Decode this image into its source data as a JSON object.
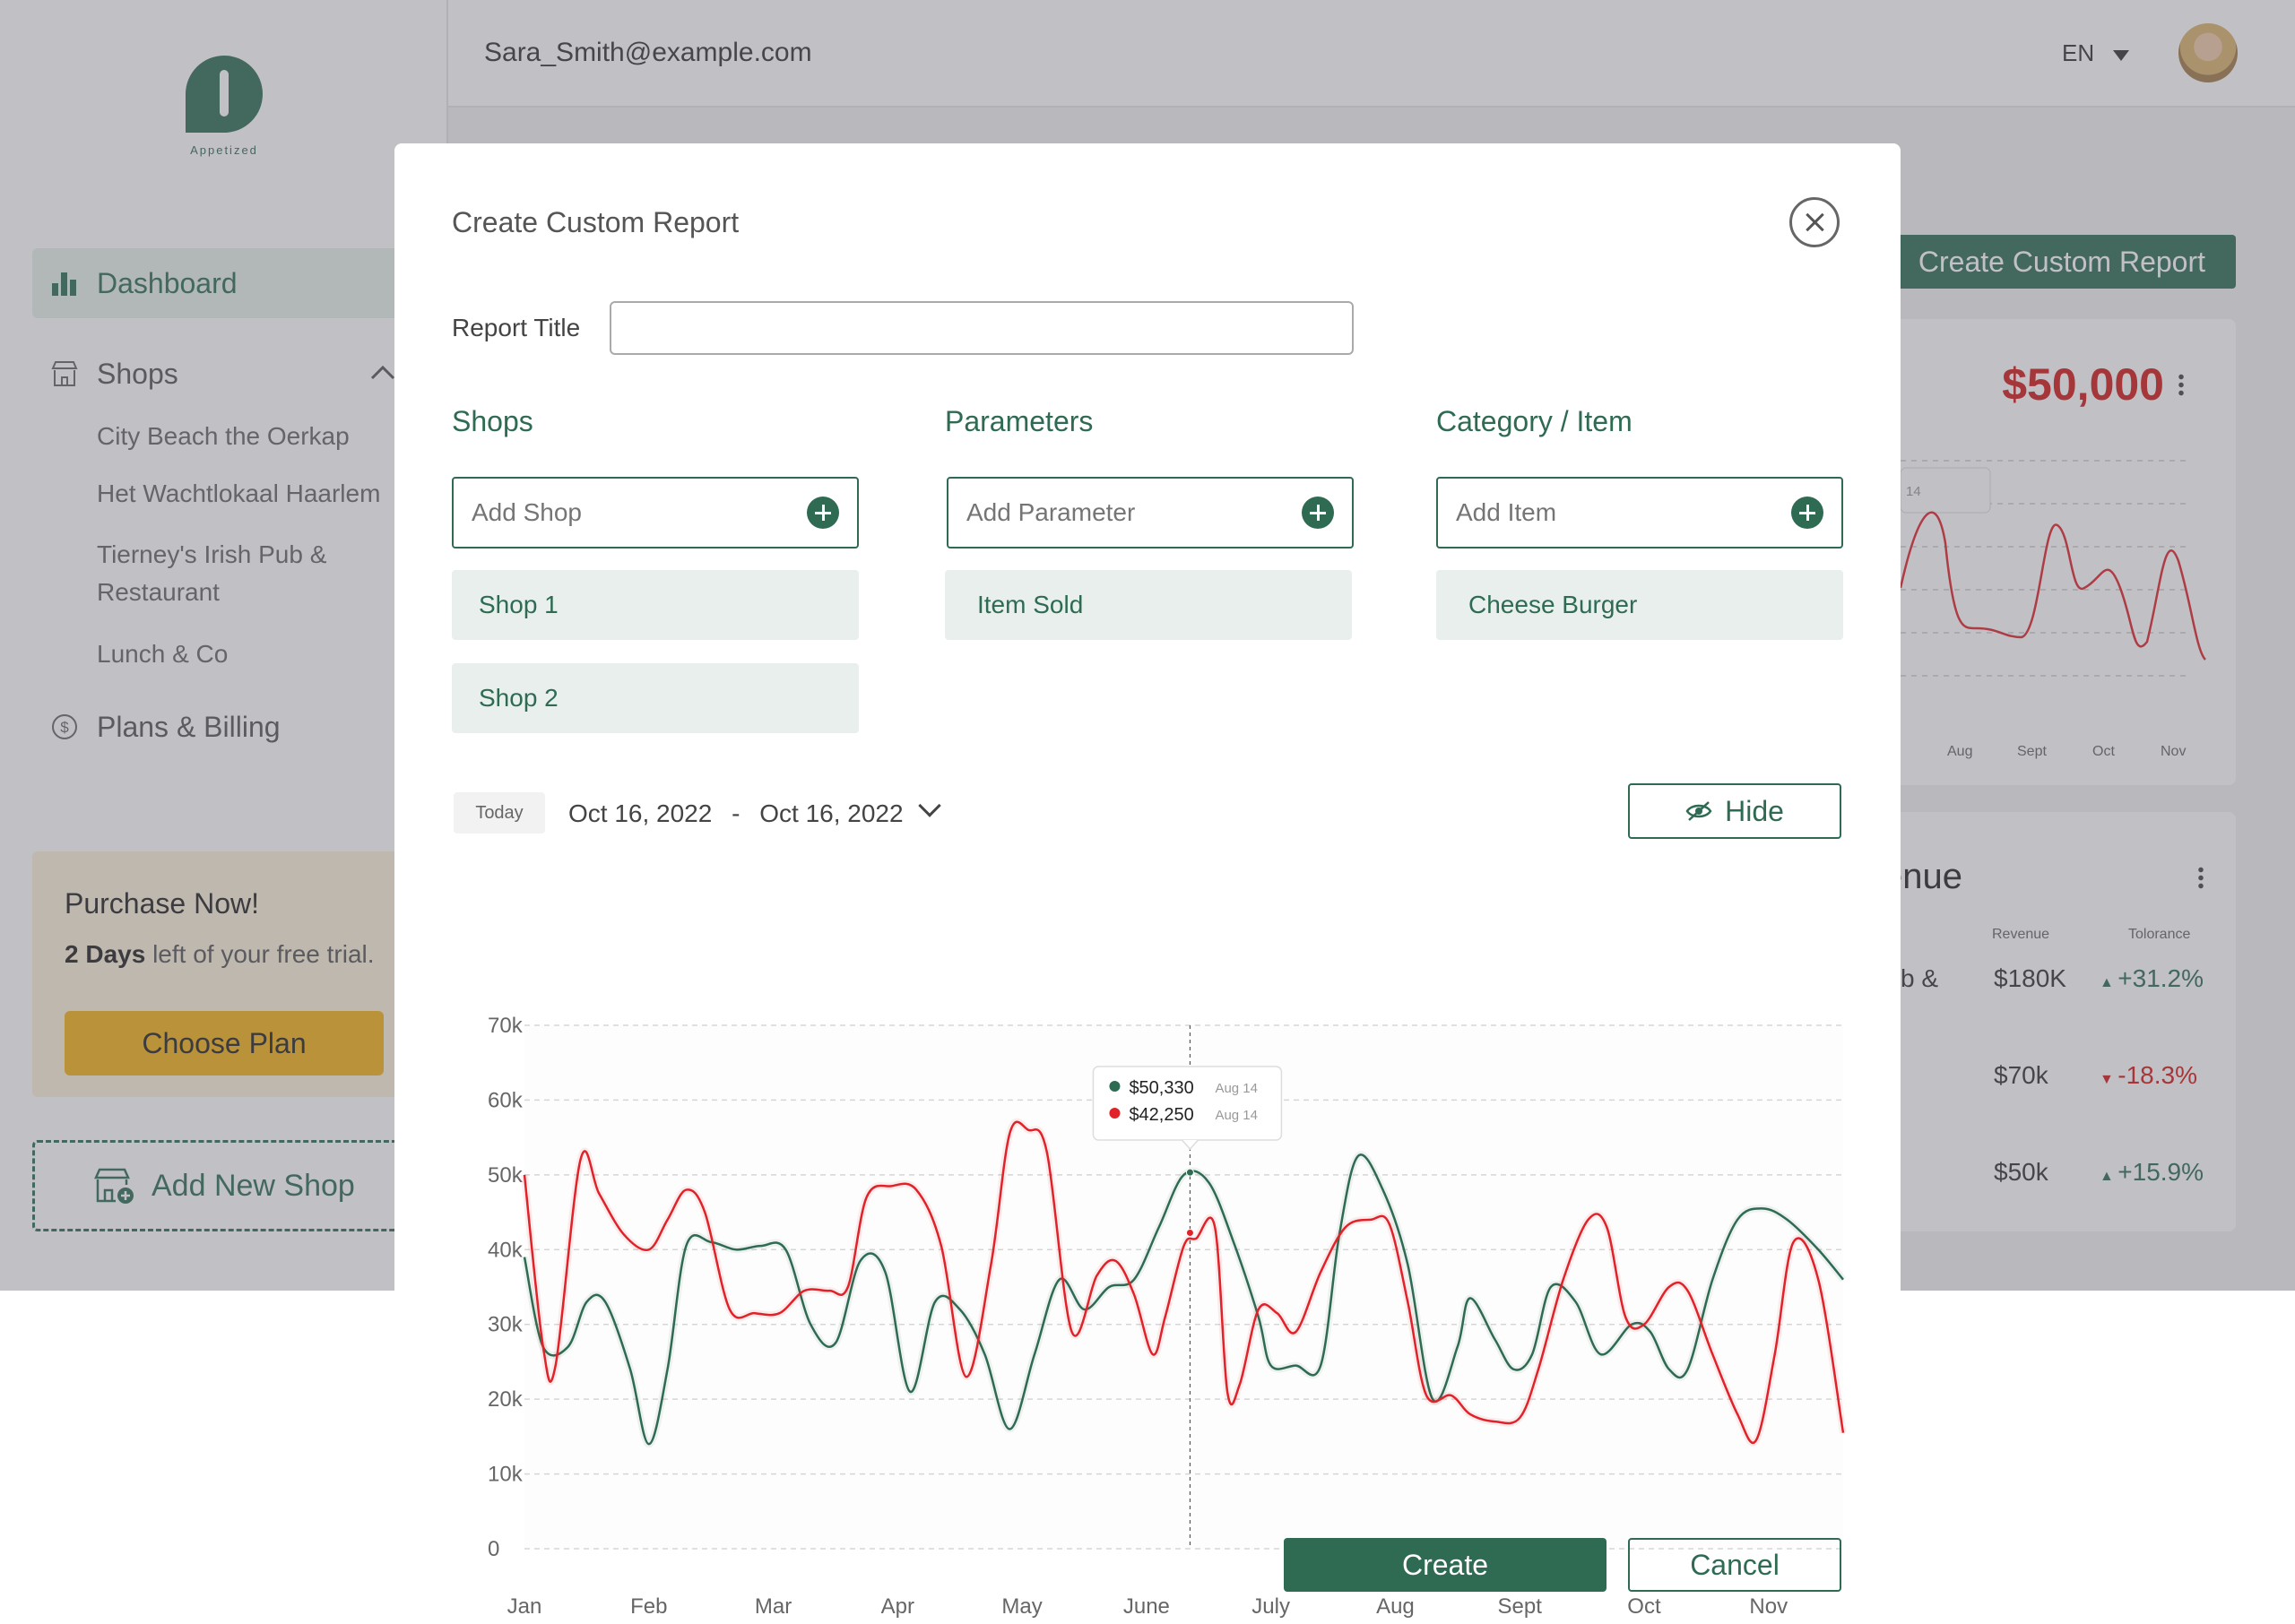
{
  "app": {
    "brand": "Appetized",
    "user_email": "Sara_Smith@example.com",
    "language": "EN",
    "sidebar": {
      "dashboard": "Dashboard",
      "shops": "Shops",
      "shop_items": [
        "City Beach the Oerkap",
        "Het Wachtlokaal Haarlem",
        "Tierney's Irish Pub &",
        "Restaurant",
        "Lunch & Co"
      ],
      "plans_billing": "Plans & Billing"
    },
    "purchase": {
      "title": "Purchase Now!",
      "trial_bold": "2 Days",
      "trial_rest": " left of your free trial.",
      "choose_plan": "Choose Plan"
    },
    "add_new_shop": "Add New Shop",
    "create_custom_report_button": "Create Custom Report",
    "revenue_card": {
      "value": "$50,000",
      "x_labels": [
        "Aug",
        "Sept",
        "Oct",
        "Nov"
      ],
      "tooltip_partial": "14"
    },
    "revenue_list": {
      "title_partial": "enue",
      "col_revenue": "Revenue",
      "col_tolerance": "Tolorance",
      "row_label_partial": "b &",
      "rows": [
        {
          "revenue": "$180K",
          "change": "+31.2%",
          "direction": "up"
        },
        {
          "revenue": "$70k",
          "change": "-18.3%",
          "direction": "down"
        },
        {
          "revenue": "$50k",
          "change": "+15.9%",
          "direction": "up"
        }
      ]
    }
  },
  "modal": {
    "title": "Create Custom Report",
    "report_title_label": "Report Title",
    "report_title_value": "",
    "columns": [
      {
        "title": "Shops",
        "placeholder": "Add Shop",
        "chips": [
          "Shop 1",
          "Shop 2"
        ]
      },
      {
        "title": "Parameters",
        "placeholder": "Add Parameter",
        "chips": [
          "Item Sold"
        ]
      },
      {
        "title": "Category / Item",
        "placeholder": "Add Item",
        "chips": [
          "Cheese Burger"
        ]
      }
    ],
    "today": "Today",
    "date_start": "Oct 16, 2022",
    "date_sep": "-",
    "date_end": "Oct 16, 2022",
    "hide": "Hide",
    "create": "Create",
    "cancel": "Cancel"
  },
  "colors": {
    "brand_green": "#2e6b52",
    "series_red": "#e0222b",
    "accent_gold": "#f2b117"
  },
  "chart_data": {
    "type": "line",
    "categories": [
      "Jan",
      "Feb",
      "Mar",
      "Apr",
      "May",
      "June",
      "July",
      "Aug",
      "Sept",
      "Oct",
      "Nov"
    ],
    "ylim": [
      0,
      70000
    ],
    "y_ticks": [
      "0",
      "10k",
      "20k",
      "30k",
      "40k",
      "50k",
      "60k",
      "70k"
    ],
    "x_range": [
      0,
      10.6
    ],
    "grid": true,
    "series": [
      {
        "color": "#2e6b52",
        "points": [
          [
            0,
            39000
          ],
          [
            0.15,
            27000
          ],
          [
            0.35,
            27000
          ],
          [
            0.5,
            33000
          ],
          [
            0.65,
            33000
          ],
          [
            0.85,
            24000
          ],
          [
            1.0,
            14000
          ],
          [
            1.15,
            24000
          ],
          [
            1.3,
            40500
          ],
          [
            1.5,
            41000
          ],
          [
            1.7,
            40000
          ],
          [
            1.9,
            40500
          ],
          [
            2.1,
            40000
          ],
          [
            2.3,
            30000
          ],
          [
            2.5,
            27500
          ],
          [
            2.7,
            38500
          ],
          [
            2.9,
            37000
          ],
          [
            3.1,
            21000
          ],
          [
            3.3,
            33000
          ],
          [
            3.5,
            32000
          ],
          [
            3.7,
            26000
          ],
          [
            3.9,
            16000
          ],
          [
            4.1,
            26000
          ],
          [
            4.3,
            36000
          ],
          [
            4.5,
            32000
          ],
          [
            4.7,
            35000
          ],
          [
            4.9,
            36000
          ],
          [
            5.1,
            43000
          ],
          [
            5.3,
            50000
          ],
          [
            5.5,
            49000
          ],
          [
            5.7,
            41000
          ],
          [
            5.9,
            31000
          ],
          [
            6.0,
            24500
          ],
          [
            6.2,
            24500
          ],
          [
            6.4,
            24500
          ],
          [
            6.55,
            42000
          ],
          [
            6.7,
            52500
          ],
          [
            6.9,
            48000
          ],
          [
            7.1,
            38000
          ],
          [
            7.3,
            20000
          ],
          [
            7.5,
            27000
          ],
          [
            7.6,
            33500
          ],
          [
            7.8,
            28000
          ],
          [
            7.95,
            24000
          ],
          [
            8.1,
            26000
          ],
          [
            8.25,
            35000
          ],
          [
            8.45,
            33000
          ],
          [
            8.65,
            26000
          ],
          [
            8.9,
            30000
          ],
          [
            9.05,
            29000
          ],
          [
            9.2,
            24000
          ],
          [
            9.35,
            24000
          ],
          [
            9.55,
            36000
          ],
          [
            9.75,
            44000
          ],
          [
            9.95,
            45500
          ],
          [
            10.15,
            44000
          ],
          [
            10.4,
            40000
          ],
          [
            10.6,
            36000
          ]
        ]
      },
      {
        "color": "#e0222b",
        "points": [
          [
            0,
            50000
          ],
          [
            0.15,
            27000
          ],
          [
            0.25,
            24500
          ],
          [
            0.45,
            52000
          ],
          [
            0.6,
            47500
          ],
          [
            0.8,
            42000
          ],
          [
            1.0,
            40000
          ],
          [
            1.15,
            44000
          ],
          [
            1.3,
            48000
          ],
          [
            1.45,
            45000
          ],
          [
            1.65,
            32000
          ],
          [
            1.85,
            31500
          ],
          [
            2.05,
            31500
          ],
          [
            2.25,
            34500
          ],
          [
            2.45,
            34500
          ],
          [
            2.6,
            35000
          ],
          [
            2.75,
            47000
          ],
          [
            2.95,
            48500
          ],
          [
            3.15,
            48000
          ],
          [
            3.35,
            40500
          ],
          [
            3.55,
            23000
          ],
          [
            3.75,
            38000
          ],
          [
            3.9,
            55500
          ],
          [
            4.05,
            56000
          ],
          [
            4.2,
            53000
          ],
          [
            4.4,
            29000
          ],
          [
            4.6,
            36500
          ],
          [
            4.75,
            38500
          ],
          [
            4.9,
            34000
          ],
          [
            5.05,
            26000
          ],
          [
            5.15,
            31000
          ],
          [
            5.3,
            40500
          ],
          [
            5.4,
            41500
          ],
          [
            5.55,
            43000
          ],
          [
            5.65,
            21000
          ],
          [
            5.75,
            22000
          ],
          [
            5.9,
            32000
          ],
          [
            6.05,
            31500
          ],
          [
            6.2,
            29000
          ],
          [
            6.4,
            37000
          ],
          [
            6.6,
            43000
          ],
          [
            6.8,
            44000
          ],
          [
            6.95,
            43500
          ],
          [
            7.1,
            33000
          ],
          [
            7.25,
            20500
          ],
          [
            7.45,
            20500
          ],
          [
            7.6,
            18000
          ],
          [
            7.8,
            17000
          ],
          [
            8.0,
            17500
          ],
          [
            8.15,
            24000
          ],
          [
            8.35,
            36000
          ],
          [
            8.55,
            44000
          ],
          [
            8.7,
            43000
          ],
          [
            8.85,
            31000
          ],
          [
            9.0,
            30000
          ],
          [
            9.2,
            35000
          ],
          [
            9.35,
            34500
          ],
          [
            9.55,
            26000
          ],
          [
            9.75,
            18000
          ],
          [
            9.9,
            14500
          ],
          [
            10.05,
            26000
          ],
          [
            10.2,
            41000
          ],
          [
            10.4,
            36000
          ],
          [
            10.6,
            15500
          ]
        ]
      }
    ],
    "tooltip": {
      "x": 5.35,
      "rows": [
        {
          "value": "$50,330",
          "date": "Aug 14",
          "color": "#2e6b52",
          "y": 50330
        },
        {
          "value": "$42,250",
          "date": "Aug 14",
          "color": "#e0222b",
          "y": 42250
        }
      ]
    }
  }
}
